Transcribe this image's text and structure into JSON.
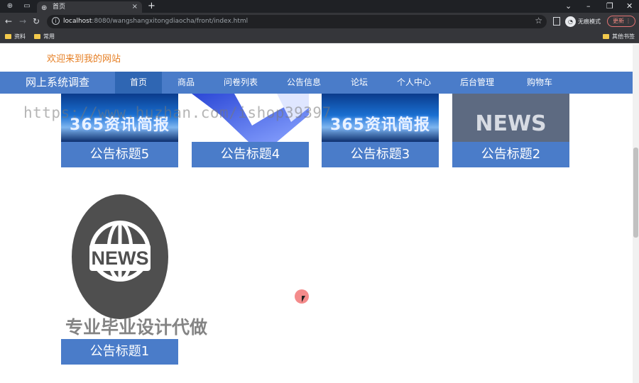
{
  "browser": {
    "tab_title": "首页",
    "url_host": "localhost",
    "url_rest": ":8080/wangshangxitongdiaocha/front/index.html",
    "incognito_label": "无痕模式",
    "update_label": "更新",
    "bookmarks": [
      "资料",
      "常用",
      "其他书签"
    ]
  },
  "site": {
    "welcome": "欢迎来到我的网站",
    "brand": "网上系统调查",
    "nav": [
      "首页",
      "商品",
      "问卷列表",
      "公告信息",
      "论坛",
      "个人中心",
      "后台管理",
      "购物车"
    ],
    "active_nav": "首页"
  },
  "cards": [
    {
      "title": "公告标题5",
      "image": "365资讯简报"
    },
    {
      "title": "公告标题4",
      "image": "blue-shape"
    },
    {
      "title": "公告标题3",
      "image": "365资讯简报"
    },
    {
      "title": "公告标题2",
      "image": "NEWS"
    },
    {
      "title": "公告标题1",
      "image": "NEWS",
      "icon": "globe-news-icon"
    }
  ],
  "overlays": {
    "watermark_url": "https://www.huzhan.com/ishop39397",
    "watermark_text": "专业毕业设计代做"
  },
  "colors": {
    "nav_bg": "#4a7cc9",
    "nav_active": "#2f66b3",
    "welcome": "#e67e22"
  }
}
